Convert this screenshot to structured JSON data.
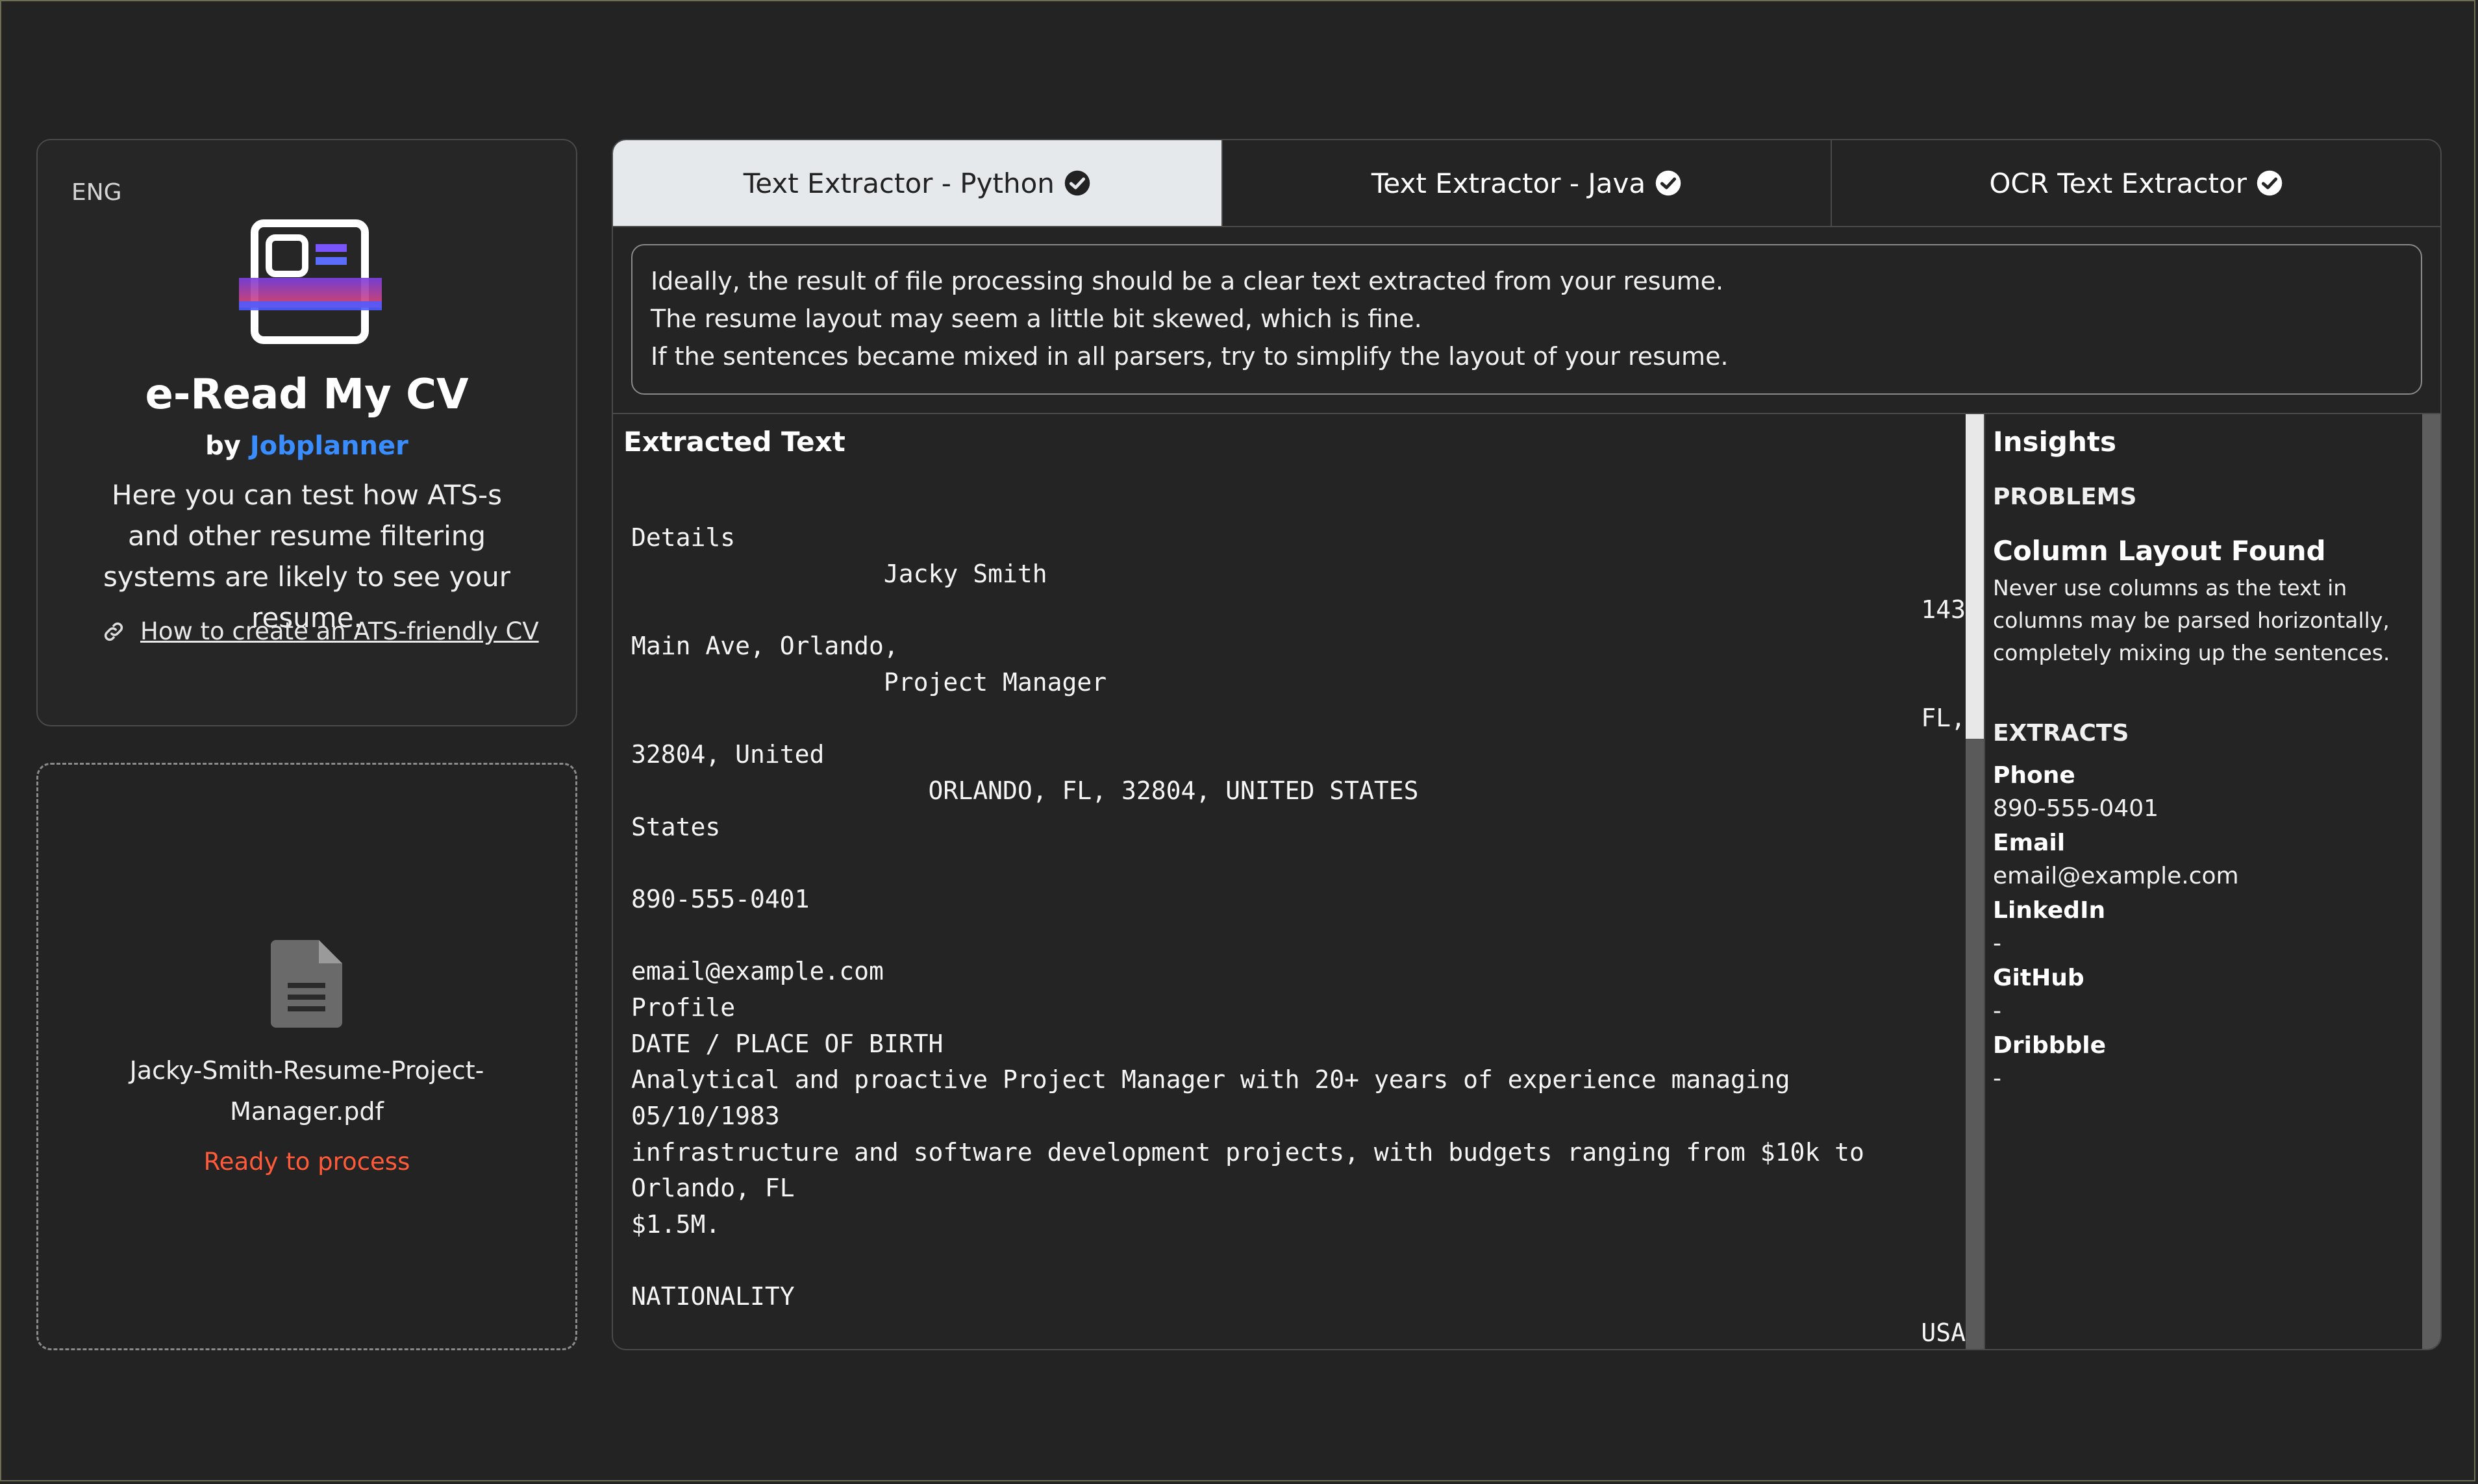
{
  "language": "ENG",
  "app": {
    "title": "e-Read My CV",
    "by_prefix": "by",
    "brand": "Jobplanner",
    "description": "Here you can test how ATS-s and other resume filtering systems are likely to see your resume.",
    "help_link": "How to create an ATS-friendly CV"
  },
  "upload": {
    "file_name": "Jacky-Smith-Resume-Project-Manager.pdf",
    "status": "Ready to process"
  },
  "tabs": [
    {
      "label": "Text Extractor - Python",
      "active": true,
      "icon": "check-circle-icon"
    },
    {
      "label": "Text Extractor - Java",
      "active": false,
      "icon": "check-circle-icon"
    },
    {
      "label": "OCR Text Extractor",
      "active": false,
      "icon": "check-circle-icon"
    }
  ],
  "notice": {
    "line1": "Ideally, the result of file processing should be a clear text extracted from your resume.",
    "line2": "The resume layout may seem a little bit skewed, which is fine.",
    "line3": "If the sentences became mixed in all parsers, try to simplify the layout of your resume."
  },
  "extracted": {
    "title": "Extracted Text",
    "lines": [
      {
        "left": "Details",
        "right": ""
      },
      {
        "left": "                 Jacky Smith",
        "right": ""
      },
      {
        "left": "",
        "right": "143"
      },
      {
        "left": "Main Ave, Orlando,",
        "right": ""
      },
      {
        "left": "                 Project Manager",
        "right": ""
      },
      {
        "left": "",
        "right": "FL,"
      },
      {
        "left": "32804, United",
        "right": ""
      },
      {
        "left": "                    ORLANDO, FL, 32804, UNITED STATES",
        "right": ""
      },
      {
        "left": "States",
        "right": ""
      },
      {
        "left": "",
        "right": ""
      },
      {
        "left": "890-555-0401",
        "right": ""
      },
      {
        "left": "",
        "right": ""
      },
      {
        "left": "email@example.com",
        "right": ""
      },
      {
        "left": "Profile",
        "right": ""
      },
      {
        "left": "DATE / PLACE OF BIRTH",
        "right": ""
      },
      {
        "left": "Analytical and proactive Project Manager with 20+ years of experience managing",
        "right": ""
      },
      {
        "left": "05/10/1983",
        "right": ""
      },
      {
        "left": "infrastructure and software development projects, with budgets ranging from $10k to",
        "right": ""
      },
      {
        "left": "Orlando, FL",
        "right": ""
      },
      {
        "left": "$1.5M.",
        "right": ""
      },
      {
        "left": "",
        "right": ""
      },
      {
        "left": "NATIONALITY",
        "right": ""
      },
      {
        "left": "",
        "right": "USA"
      }
    ]
  },
  "insights": {
    "title": "Insights",
    "problems_label": "PROBLEMS",
    "problem_title": "Column Layout Found",
    "problem_text": "Never use columns as the text in columns may be parsed horizontally, completely mixing up the sentences.",
    "extracts_label": "EXTRACTS",
    "extracts": [
      {
        "label": "Phone",
        "value": "890-555-0401"
      },
      {
        "label": "Email",
        "value": "email@example.com"
      },
      {
        "label": "LinkedIn",
        "value": "-"
      },
      {
        "label": "GitHub",
        "value": "-"
      },
      {
        "label": "Dribbble",
        "value": "-"
      }
    ]
  },
  "colors": {
    "background": "#232323",
    "brand": "#3a8dff",
    "status": "#ff5a3a",
    "active_tab": "#e6e9ec"
  }
}
